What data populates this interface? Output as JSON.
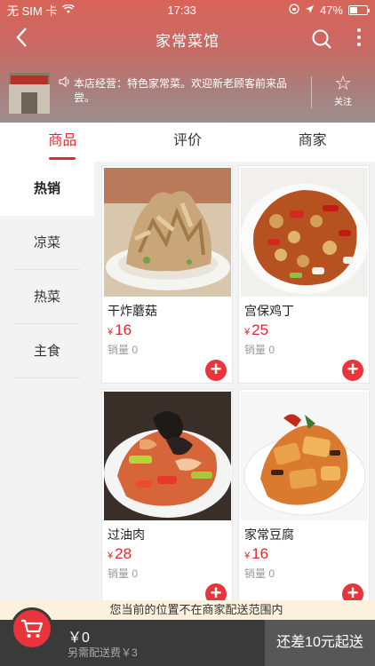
{
  "status_bar": {
    "carrier": "无 SIM 卡",
    "time": "17:33",
    "battery": "47%",
    "battery_level": 0.47
  },
  "nav": {
    "title": "家常菜馆"
  },
  "shop": {
    "notice": "本店经营：特色家常菜。欢迎新老顾客前来品尝。",
    "follow_label": "关注",
    "sign_text": "家常菜馆"
  },
  "tabs": [
    {
      "label": "商品",
      "active": true
    },
    {
      "label": "评价",
      "active": false
    },
    {
      "label": "商家",
      "active": false
    }
  ],
  "categories": [
    {
      "label": "热销",
      "active": true
    },
    {
      "label": "凉菜",
      "active": false
    },
    {
      "label": "热菜",
      "active": false
    },
    {
      "label": "主食",
      "active": false
    }
  ],
  "products": [
    {
      "name": "干炸蘑菇",
      "currency": "¥",
      "price": "16",
      "sales": "销量 0"
    },
    {
      "name": "宫保鸡丁",
      "currency": "¥",
      "price": "25",
      "sales": "销量 0"
    },
    {
      "name": "过油肉",
      "currency": "¥",
      "price": "28",
      "sales": "销量 0"
    },
    {
      "name": "家常豆腐",
      "currency": "¥",
      "price": "16",
      "sales": "销量 0"
    }
  ],
  "footer": {
    "warning": "您当前的位置不在商家配送范围内",
    "total": "￥0",
    "delivery_fee": "另需配送费￥3",
    "checkout_label": "还差10元起送"
  },
  "colors": {
    "accent": "#e0292c",
    "add_button": "#e8343a",
    "footer_bg": "#3a3a3a"
  }
}
